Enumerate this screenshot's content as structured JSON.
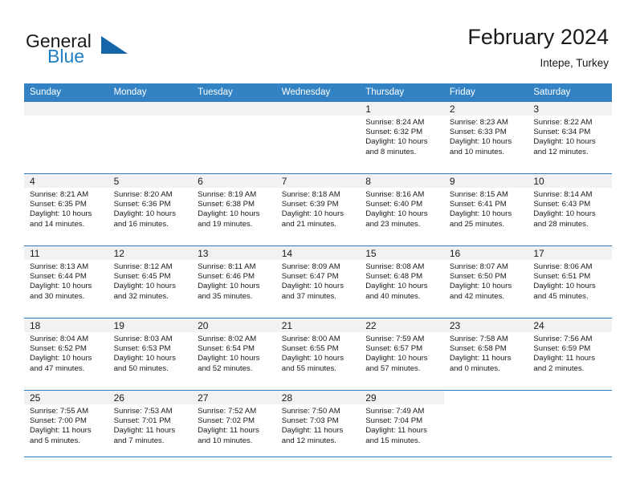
{
  "brand": {
    "name_part1": "General",
    "name_part2": "Blue",
    "triangle_color": "#1565a8",
    "blue_color": "#1f7fc4"
  },
  "header": {
    "title": "February 2024",
    "subtitle": "Intepe, Turkey",
    "header_bg_color": "#3282c4",
    "rule_color": "#2f7cbd",
    "daynum_band_color": "#f2f2f2"
  },
  "weekday_headers": [
    "Sunday",
    "Monday",
    "Tuesday",
    "Wednesday",
    "Thursday",
    "Friday",
    "Saturday"
  ],
  "weeks": [
    [
      {
        "day": "",
        "sunrise": "",
        "sunset": "",
        "daylight1": "",
        "daylight2": "",
        "empty": true
      },
      {
        "day": "",
        "sunrise": "",
        "sunset": "",
        "daylight1": "",
        "daylight2": "",
        "empty": true
      },
      {
        "day": "",
        "sunrise": "",
        "sunset": "",
        "daylight1": "",
        "daylight2": "",
        "empty": true
      },
      {
        "day": "",
        "sunrise": "",
        "sunset": "",
        "daylight1": "",
        "daylight2": "",
        "empty": true
      },
      {
        "day": "1",
        "sunrise": "Sunrise: 8:24 AM",
        "sunset": "Sunset: 6:32 PM",
        "daylight1": "Daylight: 10 hours",
        "daylight2": "and 8 minutes.",
        "empty": false
      },
      {
        "day": "2",
        "sunrise": "Sunrise: 8:23 AM",
        "sunset": "Sunset: 6:33 PM",
        "daylight1": "Daylight: 10 hours",
        "daylight2": "and 10 minutes.",
        "empty": false
      },
      {
        "day": "3",
        "sunrise": "Sunrise: 8:22 AM",
        "sunset": "Sunset: 6:34 PM",
        "daylight1": "Daylight: 10 hours",
        "daylight2": "and 12 minutes.",
        "empty": false
      }
    ],
    [
      {
        "day": "4",
        "sunrise": "Sunrise: 8:21 AM",
        "sunset": "Sunset: 6:35 PM",
        "daylight1": "Daylight: 10 hours",
        "daylight2": "and 14 minutes.",
        "empty": false
      },
      {
        "day": "5",
        "sunrise": "Sunrise: 8:20 AM",
        "sunset": "Sunset: 6:36 PM",
        "daylight1": "Daylight: 10 hours",
        "daylight2": "and 16 minutes.",
        "empty": false
      },
      {
        "day": "6",
        "sunrise": "Sunrise: 8:19 AM",
        "sunset": "Sunset: 6:38 PM",
        "daylight1": "Daylight: 10 hours",
        "daylight2": "and 19 minutes.",
        "empty": false
      },
      {
        "day": "7",
        "sunrise": "Sunrise: 8:18 AM",
        "sunset": "Sunset: 6:39 PM",
        "daylight1": "Daylight: 10 hours",
        "daylight2": "and 21 minutes.",
        "empty": false
      },
      {
        "day": "8",
        "sunrise": "Sunrise: 8:16 AM",
        "sunset": "Sunset: 6:40 PM",
        "daylight1": "Daylight: 10 hours",
        "daylight2": "and 23 minutes.",
        "empty": false
      },
      {
        "day": "9",
        "sunrise": "Sunrise: 8:15 AM",
        "sunset": "Sunset: 6:41 PM",
        "daylight1": "Daylight: 10 hours",
        "daylight2": "and 25 minutes.",
        "empty": false
      },
      {
        "day": "10",
        "sunrise": "Sunrise: 8:14 AM",
        "sunset": "Sunset: 6:43 PM",
        "daylight1": "Daylight: 10 hours",
        "daylight2": "and 28 minutes.",
        "empty": false
      }
    ],
    [
      {
        "day": "11",
        "sunrise": "Sunrise: 8:13 AM",
        "sunset": "Sunset: 6:44 PM",
        "daylight1": "Daylight: 10 hours",
        "daylight2": "and 30 minutes.",
        "empty": false
      },
      {
        "day": "12",
        "sunrise": "Sunrise: 8:12 AM",
        "sunset": "Sunset: 6:45 PM",
        "daylight1": "Daylight: 10 hours",
        "daylight2": "and 32 minutes.",
        "empty": false
      },
      {
        "day": "13",
        "sunrise": "Sunrise: 8:11 AM",
        "sunset": "Sunset: 6:46 PM",
        "daylight1": "Daylight: 10 hours",
        "daylight2": "and 35 minutes.",
        "empty": false
      },
      {
        "day": "14",
        "sunrise": "Sunrise: 8:09 AM",
        "sunset": "Sunset: 6:47 PM",
        "daylight1": "Daylight: 10 hours",
        "daylight2": "and 37 minutes.",
        "empty": false
      },
      {
        "day": "15",
        "sunrise": "Sunrise: 8:08 AM",
        "sunset": "Sunset: 6:48 PM",
        "daylight1": "Daylight: 10 hours",
        "daylight2": "and 40 minutes.",
        "empty": false
      },
      {
        "day": "16",
        "sunrise": "Sunrise: 8:07 AM",
        "sunset": "Sunset: 6:50 PM",
        "daylight1": "Daylight: 10 hours",
        "daylight2": "and 42 minutes.",
        "empty": false
      },
      {
        "day": "17",
        "sunrise": "Sunrise: 8:06 AM",
        "sunset": "Sunset: 6:51 PM",
        "daylight1": "Daylight: 10 hours",
        "daylight2": "and 45 minutes.",
        "empty": false
      }
    ],
    [
      {
        "day": "18",
        "sunrise": "Sunrise: 8:04 AM",
        "sunset": "Sunset: 6:52 PM",
        "daylight1": "Daylight: 10 hours",
        "daylight2": "and 47 minutes.",
        "empty": false
      },
      {
        "day": "19",
        "sunrise": "Sunrise: 8:03 AM",
        "sunset": "Sunset: 6:53 PM",
        "daylight1": "Daylight: 10 hours",
        "daylight2": "and 50 minutes.",
        "empty": false
      },
      {
        "day": "20",
        "sunrise": "Sunrise: 8:02 AM",
        "sunset": "Sunset: 6:54 PM",
        "daylight1": "Daylight: 10 hours",
        "daylight2": "and 52 minutes.",
        "empty": false
      },
      {
        "day": "21",
        "sunrise": "Sunrise: 8:00 AM",
        "sunset": "Sunset: 6:55 PM",
        "daylight1": "Daylight: 10 hours",
        "daylight2": "and 55 minutes.",
        "empty": false
      },
      {
        "day": "22",
        "sunrise": "Sunrise: 7:59 AM",
        "sunset": "Sunset: 6:57 PM",
        "daylight1": "Daylight: 10 hours",
        "daylight2": "and 57 minutes.",
        "empty": false
      },
      {
        "day": "23",
        "sunrise": "Sunrise: 7:58 AM",
        "sunset": "Sunset: 6:58 PM",
        "daylight1": "Daylight: 11 hours",
        "daylight2": "and 0 minutes.",
        "empty": false
      },
      {
        "day": "24",
        "sunrise": "Sunrise: 7:56 AM",
        "sunset": "Sunset: 6:59 PM",
        "daylight1": "Daylight: 11 hours",
        "daylight2": "and 2 minutes.",
        "empty": false
      }
    ],
    [
      {
        "day": "25",
        "sunrise": "Sunrise: 7:55 AM",
        "sunset": "Sunset: 7:00 PM",
        "daylight1": "Daylight: 11 hours",
        "daylight2": "and 5 minutes.",
        "empty": false
      },
      {
        "day": "26",
        "sunrise": "Sunrise: 7:53 AM",
        "sunset": "Sunset: 7:01 PM",
        "daylight1": "Daylight: 11 hours",
        "daylight2": "and 7 minutes.",
        "empty": false
      },
      {
        "day": "27",
        "sunrise": "Sunrise: 7:52 AM",
        "sunset": "Sunset: 7:02 PM",
        "daylight1": "Daylight: 11 hours",
        "daylight2": "and 10 minutes.",
        "empty": false
      },
      {
        "day": "28",
        "sunrise": "Sunrise: 7:50 AM",
        "sunset": "Sunset: 7:03 PM",
        "daylight1": "Daylight: 11 hours",
        "daylight2": "and 12 minutes.",
        "empty": false
      },
      {
        "day": "29",
        "sunrise": "Sunrise: 7:49 AM",
        "sunset": "Sunset: 7:04 PM",
        "daylight1": "Daylight: 11 hours",
        "daylight2": "and 15 minutes.",
        "empty": false
      },
      {
        "day": "",
        "sunrise": "",
        "sunset": "",
        "daylight1": "",
        "daylight2": "",
        "empty": true
      },
      {
        "day": "",
        "sunrise": "",
        "sunset": "",
        "daylight1": "",
        "daylight2": "",
        "empty": true
      }
    ]
  ]
}
